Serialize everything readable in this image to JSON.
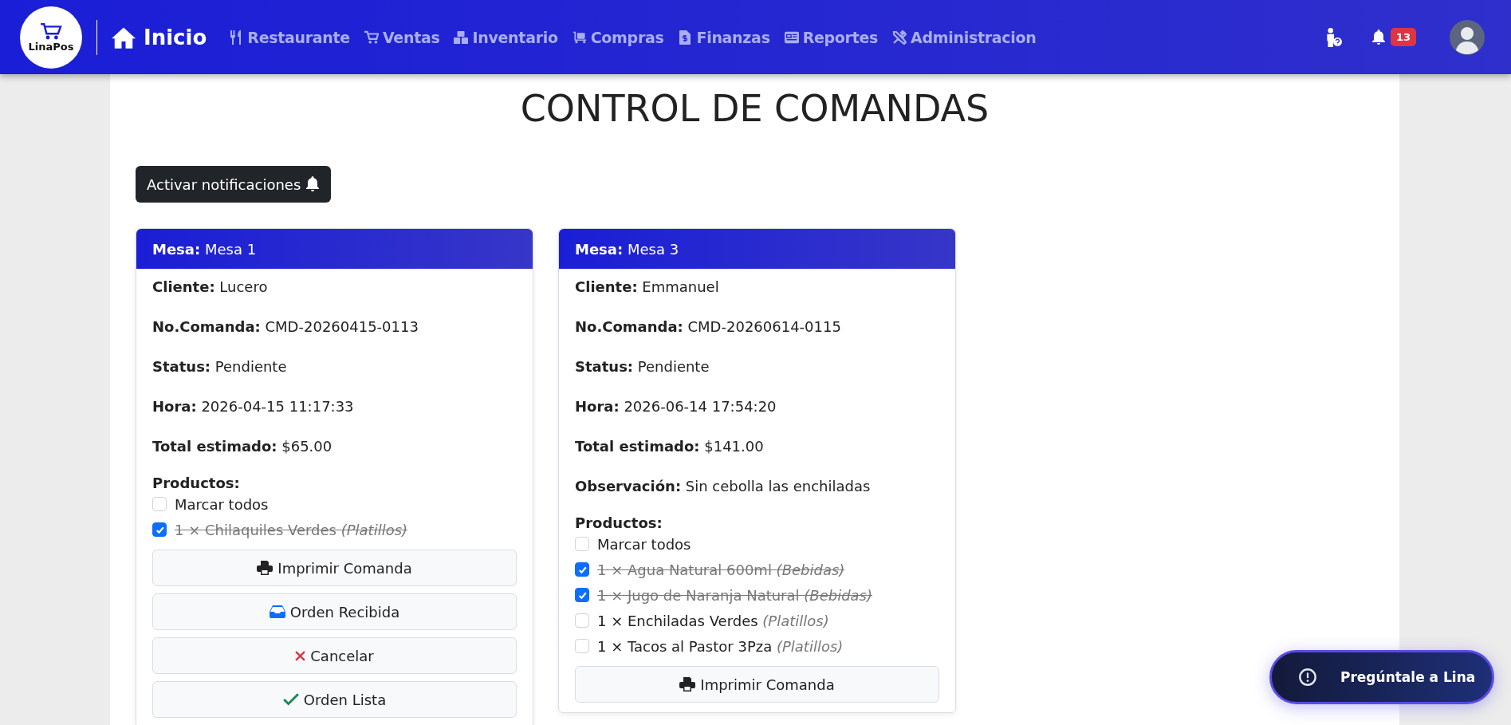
{
  "navbar": {
    "logo_text": "LinaPos",
    "home": "Inicio",
    "menu": [
      {
        "label": "Restaurante",
        "kind": "utensils"
      },
      {
        "label": "Ventas",
        "kind": "cart"
      },
      {
        "label": "Inventario",
        "kind": "boxes"
      },
      {
        "label": "Compras",
        "kind": "dolly"
      },
      {
        "label": "Finanzas",
        "kind": "invoice"
      },
      {
        "label": "Reportes",
        "kind": "newspaper"
      },
      {
        "label": "Administracion",
        "kind": "tools"
      }
    ],
    "notification_count": "13"
  },
  "page_title": "CONTROL DE COMANDAS",
  "notify_button": "Activar notificaciones",
  "orders": [
    {
      "header_label": "Mesa:",
      "header_value": "Mesa 1",
      "fields": [
        {
          "label": "Cliente:",
          "value": "Lucero"
        },
        {
          "label": "No.Comanda:",
          "value": "CMD-20260415-0113"
        },
        {
          "label": "Status:",
          "value": "Pendiente"
        },
        {
          "label": "Hora:",
          "value": "2026-04-15 11:17:33"
        },
        {
          "label": "Total estimado:",
          "value": "$65.00"
        }
      ],
      "products_label": "Productos:",
      "select_all": {
        "label": "Marcar todos",
        "checked": false
      },
      "products": [
        {
          "name": "1 × Chilaquiles Verdes",
          "category": "(Platillos)",
          "checked": true
        }
      ],
      "buttons": [
        {
          "label": "Imprimir Comanda",
          "kind": "print"
        },
        {
          "label": "Orden Recibida",
          "kind": "inbox"
        },
        {
          "label": "Cancelar",
          "kind": "cancel"
        },
        {
          "label": "Orden Lista",
          "kind": "ready"
        }
      ]
    },
    {
      "header_label": "Mesa:",
      "header_value": "Mesa 3",
      "fields": [
        {
          "label": "Cliente:",
          "value": "Emmanuel"
        },
        {
          "label": "No.Comanda:",
          "value": "CMD-20260614-0115"
        },
        {
          "label": "Status:",
          "value": "Pendiente"
        },
        {
          "label": "Hora:",
          "value": "2026-06-14 17:54:20"
        },
        {
          "label": "Total estimado:",
          "value": "$141.00"
        },
        {
          "label": "Observación:",
          "value": "Sin cebolla las enchiladas"
        }
      ],
      "products_label": "Productos:",
      "select_all": {
        "label": "Marcar todos",
        "checked": false
      },
      "products": [
        {
          "name": "1 × Agua Natural 600ml",
          "category": "(Bebidas)",
          "checked": true
        },
        {
          "name": "1 × Jugo de Naranja Natural",
          "category": "(Bebidas)",
          "checked": true
        },
        {
          "name": "1 × Enchiladas Verdes",
          "category": "(Platillos)",
          "checked": false
        },
        {
          "name": "1 × Tacos al Pastor 3Pza",
          "category": "(Platillos)",
          "checked": false
        }
      ],
      "buttons": [
        {
          "label": "Imprimir Comanda",
          "kind": "print"
        }
      ]
    }
  ],
  "assistant_button": "Pregúntale a Lina"
}
